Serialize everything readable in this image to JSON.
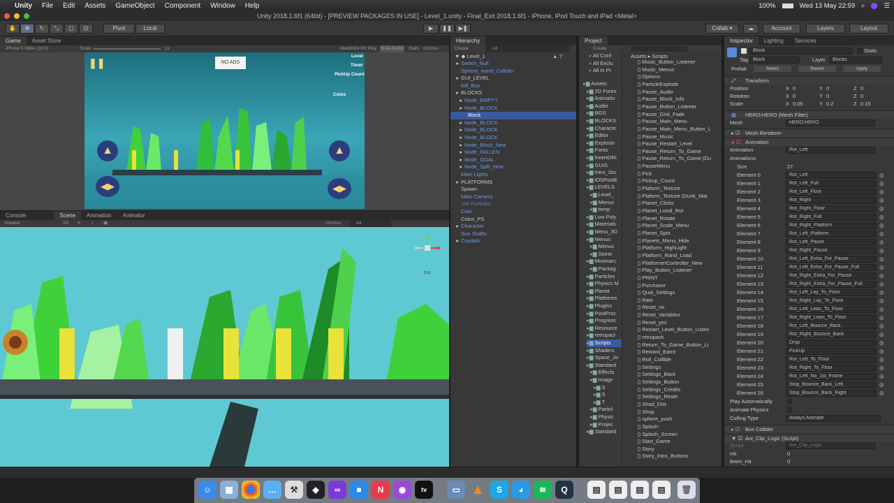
{
  "menubar": {
    "apple": "",
    "items": [
      "Unity",
      "File",
      "Edit",
      "Assets",
      "GameObject",
      "Component",
      "Window",
      "Help"
    ],
    "battery": "100%",
    "datetime": "Wed 13 May  22:59"
  },
  "window_title": "Unity 2018.1.6f1 (64bit) - [PREVIEW PACKAGES IN USE] - Level_1.unity - Final_Exit 2018.1.6f1 - iPhone, iPod Touch and iPad <Metal>",
  "toolbar": {
    "pivot": "Pivot",
    "local": "Local",
    "collab": "Collab ▾",
    "account": "Account",
    "layers": "Layers",
    "layout": "Layout"
  },
  "game_view": {
    "tabs": [
      "Game",
      "Asset Store"
    ],
    "resolution": "iPhone 5 Wide (16:9)",
    "scale_label": "Scale",
    "scale_value": "1x",
    "maximize": "Maximize On Play",
    "mute": "Mute Audio",
    "stats": "Stats",
    "gizmos": "Gizmos",
    "no_ads": "NO ADS",
    "hud": [
      "Level",
      "Timer",
      "PickUp Count",
      "Coins"
    ]
  },
  "scene_view": {
    "tabs": [
      "Console",
      "Scene",
      "Animation",
      "Animator"
    ],
    "shaded": "Shaded",
    "mode_2d": "2D",
    "gizmos": "Gizmos",
    "search": "All",
    "iso": "Iso"
  },
  "hierarchy": {
    "title": "Hierarchy",
    "create": "Create",
    "search": "All",
    "scene": "Level_1",
    "items": [
      {
        "label": "Switch_Null",
        "style": "blue"
      },
      {
        "label": "Sphere_Hand_Collider",
        "style": "blue"
      },
      {
        "label": "GUI_LEVEL",
        "style": "norm"
      },
      {
        "label": "Kill_Box",
        "style": "blue"
      },
      {
        "label": "BLOCKS",
        "style": "norm"
      },
      {
        "label": "Node_EMPTY",
        "style": "blue"
      },
      {
        "label": "Node_BLOCK",
        "style": "blue"
      },
      {
        "label": "Block",
        "style": "sel"
      },
      {
        "label": "Node_BLOCK",
        "style": "blue"
      },
      {
        "label": "Node_BLOCK",
        "style": "blue"
      },
      {
        "label": "Node_BLOCK",
        "style": "blue"
      },
      {
        "label": "Node_Block_New",
        "style": "blue"
      },
      {
        "label": "Node_FALLEN",
        "style": "blue"
      },
      {
        "label": "Node_GOAL",
        "style": "blue"
      },
      {
        "label": "Node_Split_New",
        "style": "blue"
      },
      {
        "label": "Main Lights",
        "style": "blue"
      },
      {
        "label": "PLATFORMS",
        "style": "norm"
      },
      {
        "label": "Spawn",
        "style": "norm"
      },
      {
        "label": "Main Camera",
        "style": "blue"
      },
      {
        "label": "Silk Particles",
        "style": "dim"
      },
      {
        "label": "Coin",
        "style": "blue"
      },
      {
        "label": "Coins_PS",
        "style": "norm"
      },
      {
        "label": "Character",
        "style": "blue"
      },
      {
        "label": "Sun Shafts",
        "style": "blue"
      },
      {
        "label": "Crystals",
        "style": "blue"
      }
    ],
    "warnings": "7"
  },
  "project": {
    "title": "Project",
    "create": "Create",
    "breadcrumb": [
      "Assets",
      "Scripts"
    ],
    "favorites": [
      "All Conf",
      "All Exclu",
      "All In Pr"
    ],
    "folders": [
      "Assets",
      "2D Fores",
      "Animatio",
      "Audio",
      "BGS",
      "BLOCKS",
      "Characte",
      "Editor",
      "Explosio",
      "Fonts",
      "freeHDRI",
      "GUIS",
      "Intro_Sto",
      "iOSPostE",
      "LEVELS",
      "Level_",
      "Menus",
      "temp",
      "Low Poly",
      "Materials",
      "Menu_3D",
      "Menus",
      "Menus",
      "Stone",
      "Movinarc",
      "Packag",
      "Particles",
      "Physics M",
      "Planet",
      "Platforms",
      "Plugins",
      "PostProc",
      "Progress",
      "Resource",
      "retropacl",
      "Scripts",
      "Shaders",
      "Space_Jo",
      "Standard",
      "Effects",
      "Image",
      "S",
      "S",
      "T",
      "Particl",
      "Physic",
      "Projec",
      "Standard"
    ],
    "scripts": [
      "Music_Button_Listener",
      "Music_Menus",
      "Options",
      "ParticleExplode",
      "Pause_Audio",
      "Pause_Block_Info",
      "Pause_Button_Listener",
      "Pause_Grid_Fade",
      "Pause_Main_Menu",
      "Pause_Main_Menu_Button_L",
      "Pause_Music",
      "Pause_Restart_Level",
      "Pause_Return_To_Game",
      "Pause_Return_To_Game (Du",
      "PauseMenu",
      "Pick",
      "Pickup_Count",
      "Plaform_Texture",
      "Plaform_Texture (Dunk_Mat",
      "Planet_Clicks",
      "Planet_Local_Rot",
      "Planet_Rotate",
      "Planet_Scale_Menu",
      "Planet_Spin",
      "Planets_Menu_Hide",
      "Platform_HighLight",
      "Platform_Rand_Load",
      "PlatformerController_New",
      "Play_Button_Listener",
      "PRINT",
      "Purchaser",
      "Qual_Settings",
      "Rate",
      "Reset_no",
      "Reset_Variables",
      "Reset_yes",
      "Restart_Level_Button_Listen",
      "retropack",
      "Return_To_Game_Button_Li",
      "Reward_Earnt",
      "Roll_Colllide",
      "Settings",
      "Settings_Back",
      "Settings_Button",
      "Settings_Credits",
      "Settings_Reset",
      "Shad_Dist",
      "Shop",
      "sphere_push",
      "Splash",
      "Splash_Screen",
      "Start_Game",
      "Story",
      "Story_Intro_Buttons"
    ]
  },
  "inspector": {
    "tabs": [
      "Inspector",
      "Lighting",
      "Services"
    ],
    "object_name": "Block",
    "static": "Static",
    "tag_label": "Tag",
    "tag": "Block",
    "layer_label": "Layer",
    "layer": "Blocks",
    "prefab_label": "Prefab",
    "prefab_select": "Select",
    "prefab_revert": "Revert",
    "prefab_apply": "Apply",
    "transform": {
      "title": "Transform",
      "position": {
        "label": "Position",
        "x": "0",
        "y": "0",
        "z": "0"
      },
      "rotation": {
        "label": "Rotation",
        "x": "0",
        "y": "0",
        "z": "0"
      },
      "scale": {
        "label": "Scale",
        "x": "0.05",
        "y": "0.2",
        "z": "0.15"
      }
    },
    "mesh_filter": {
      "title": "HERO:HERO (Mesh Filter)",
      "mesh_label": "Mesh",
      "mesh": "HERO:HERO"
    },
    "mesh_renderer": "Mesh Renderer",
    "animation": {
      "title": "Animation",
      "animation_label": "Animation",
      "animation_value": "Rot_Left",
      "animations_label": "Animations",
      "size_label": "Size",
      "size": "27",
      "elements": [
        {
          "label": "Element 0",
          "value": "Rot_Left"
        },
        {
          "label": "Element 1",
          "value": "Rot_Left_Full"
        },
        {
          "label": "Element 2",
          "value": "Rot_Left_Floor"
        },
        {
          "label": "Element 3",
          "value": "Rot_Right"
        },
        {
          "label": "Element 4",
          "value": "Rot_Right_Floor"
        },
        {
          "label": "Element 5",
          "value": "Rot_Right_Full"
        },
        {
          "label": "Element 6",
          "value": "Rot_Right_Platform"
        },
        {
          "label": "Element 7",
          "value": "Rot_Left_Platform"
        },
        {
          "label": "Element 8",
          "value": "Rot_Left_Pause"
        },
        {
          "label": "Element 9",
          "value": "Rot_Right_Pause"
        },
        {
          "label": "Element 10",
          "value": "Rot_Left_Extra_For_Pause"
        },
        {
          "label": "Element 11",
          "value": "Rot_Left_Extra_For_Pause_Full"
        },
        {
          "label": "Element 12",
          "value": "Rot_Right_Extra_For_Pause"
        },
        {
          "label": "Element 13",
          "value": "Rot_Right_Extra_For_Pause_Full"
        },
        {
          "label": "Element 14",
          "value": "Rot_Left_Lay_To_Floor"
        },
        {
          "label": "Element 15",
          "value": "Rot_Right_Lay_To_Floor"
        },
        {
          "label": "Element 16",
          "value": "Rot_Left_Lean_To_Floor"
        },
        {
          "label": "Element 17",
          "value": "Rot_Right_Lean_To_Floor"
        },
        {
          "label": "Element 18",
          "value": "Rot_Left_Bounce_Back"
        },
        {
          "label": "Element 19",
          "value": "Rot_Right_Bounce_Back"
        },
        {
          "label": "Element 20",
          "value": "Drop"
        },
        {
          "label": "Element 21",
          "value": "PickUp"
        },
        {
          "label": "Element 22",
          "value": "Rot_Left_To_Floor"
        },
        {
          "label": "Element 23",
          "value": "Rot_Right_To_Floor"
        },
        {
          "label": "Element 24",
          "value": "Rot_Left_No_1st_Frame"
        },
        {
          "label": "Element 25",
          "value": "Stop_Bounce_Back_Left"
        },
        {
          "label": "Element 26",
          "value": "Stop_Bounce_Back_Right"
        }
      ],
      "play_auto": "Play Automatically",
      "animate_physics": "Animate Physics",
      "culling_label": "Culling Type",
      "culling": "Always Animate"
    },
    "box_collider": "Box Collider",
    "script_comp": {
      "title": "Ani_Clip_Logic (Script)",
      "script_label": "Script",
      "script": "Ani_Clip_Logic",
      "hit_label": "Hit",
      "hit": "0",
      "been_hit_label": "Been_Hit",
      "been_hit": "0"
    }
  },
  "colors": {
    "accent": "#3a5a9e",
    "link_blue": "#6b9be8",
    "crystal_green": "#3fd13a",
    "sky": "#5fc9d3"
  }
}
